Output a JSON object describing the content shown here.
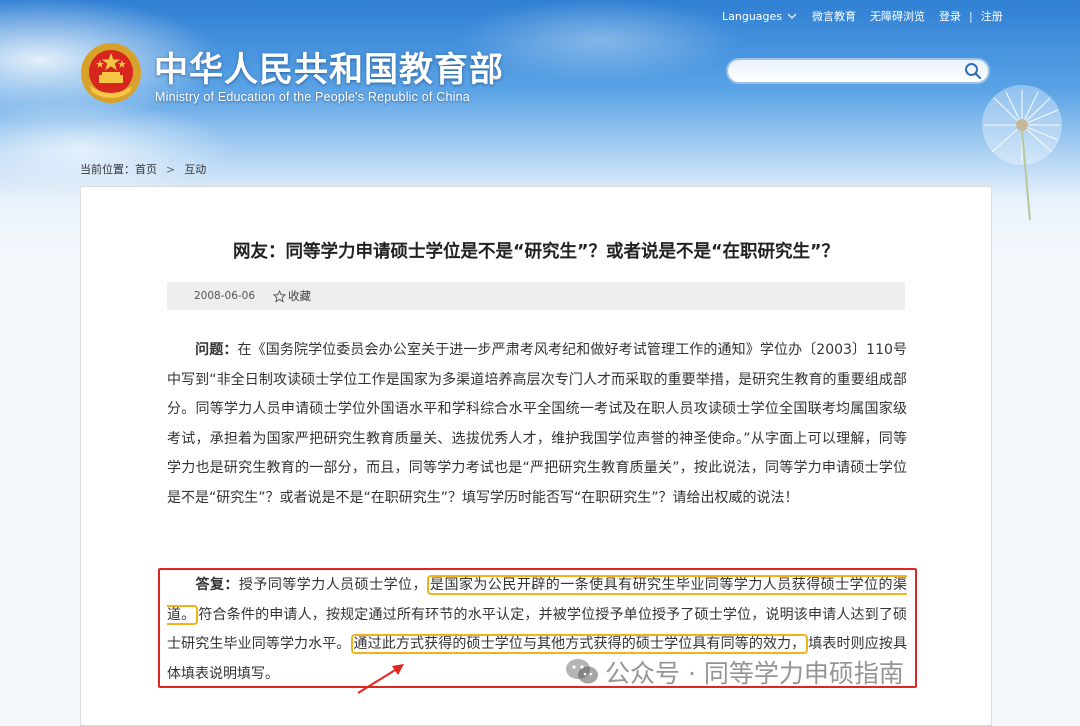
{
  "header": {
    "languages_label": "Languages",
    "links": [
      "微言教育",
      "无障碍浏览"
    ],
    "login_label": "登录",
    "register_label": "注册",
    "separator": "|",
    "site_title": "中华人民共和国教育部",
    "site_subtitle": "Ministry of Education of the People's Republic of China"
  },
  "search": {
    "placeholder": ""
  },
  "breadcrumb": {
    "prefix": "当前位置：",
    "home": "首页",
    "separator": ">",
    "current": "互动"
  },
  "article": {
    "title": "网友：同等学力申请硕士学位是不是“研究生”？或者说是不是“在职研究生”？",
    "date": "2008-06-06",
    "favorite_label": "收藏",
    "question_label": "问题：",
    "question_text": "在《国务院学位委员会办公室关于进一步严肃考风考纪和做好考试管理工作的通知》学位办〔2003〕110号中写到“非全日制攻读硕士学位工作是国家为多渠道培养高层次专门人才而采取的重要举措，是研究生教育的重要组成部分。同等学力人员申请硕士学位外国语水平和学科综合水平全国统一考试及在职人员攻读硕士学位全国联考均属国家级考试，承担着为国家严把研究生教育质量关、选拔优秀人才，维护我国学位声誉的神圣使命。”从字面上可以理解，同等学力也是研究生教育的一部分，而且，同等学力考试也是“严把研究生教育质量关”，按此说法，同等学力申请硕士学位是不是“研究生”？或者说是不是“在职研究生”？填写学历时能否写“在职研究生”？请给出权威的说法！",
    "answer_label": "答复：",
    "answer_part1": "授予同等学力人员硕士学位，",
    "answer_highlight1": "是国家为公民开辟的一条使具有研究生毕业同等学力人员获得硕士学位的渠道。",
    "answer_part2": "符合条件的申请人，按规定通过所有环节的水平认定，并被学位授予单位授予了硕士学位，说明该申请人达到了硕士研究生毕业同等学力水平。",
    "answer_highlight2": "通过此方式获得的硕士学位与其他方式获得的硕士学位具有同等的效力，",
    "answer_part3": "填表时则应按具体填表说明填写。"
  },
  "watermark": {
    "text": "公众号 · 同等学力申硕指南"
  },
  "colors": {
    "highlight_box": "#e0261f",
    "highlight_text": "#f3b21a",
    "sky": "#2f7fd3"
  }
}
